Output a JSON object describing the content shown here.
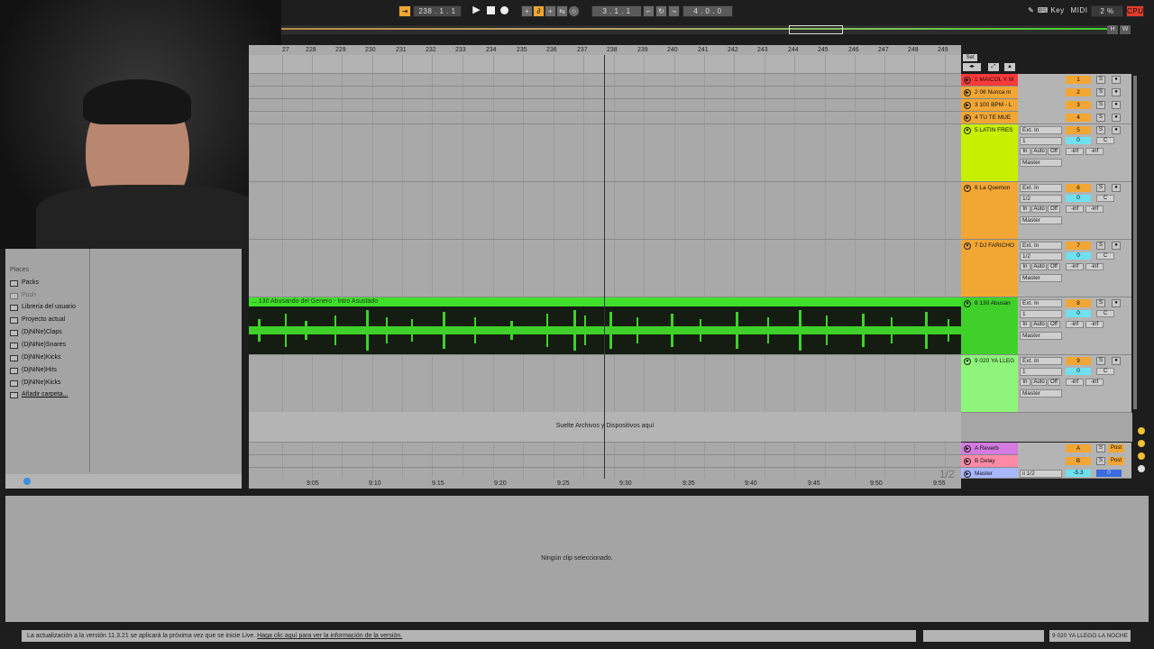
{
  "transport": {
    "arrangement_position": "238 .  1 .  1",
    "loop_start": "3 .  1 .  1",
    "loop_length": "4 .  0 .  0",
    "key_label": "Key",
    "midi_label": "MIDI",
    "cpu_value": "2 %",
    "cpu_label": "CPU",
    "h_label": "H",
    "w_label": "W"
  },
  "ruler": {
    "bars": [
      "27",
      "228",
      "229",
      "230",
      "231",
      "232",
      "233",
      "234",
      "235",
      "236",
      "237",
      "238",
      "239",
      "240",
      "241",
      "242",
      "243",
      "244",
      "245",
      "246",
      "247",
      "248",
      "249"
    ],
    "times": [
      "9:05",
      "9:10",
      "9:15",
      "9:20",
      "9:25",
      "9:30",
      "9:35",
      "9:40",
      "9:45",
      "9:50",
      "9:55"
    ],
    "set_label": "Set",
    "page_indicator": "1/2"
  },
  "tracks": [
    {
      "name": "1 MAICOL Y M",
      "number": "1",
      "color": "#ff3a3a"
    },
    {
      "name": "2 06 Nunca m",
      "number": "2",
      "color": "#f2a634"
    },
    {
      "name": "3 100 BPM - L",
      "number": "3",
      "color": "#f2a634"
    },
    {
      "name": "4 TU TE MUE",
      "number": "4",
      "color": "#f2a634"
    },
    {
      "name": "5 LATIN FRES",
      "number": "5",
      "color": "#c7f000",
      "input": "Ext. In",
      "channel": "1",
      "volume": "0",
      "pan": "C",
      "monitor": [
        "In",
        "Auto",
        "Off"
      ],
      "out": "Master",
      "inf1": "-inf",
      "inf2": "-inf"
    },
    {
      "name": "6 La Quemon",
      "number": "6",
      "color": "#f2a634",
      "input": "Ext. In",
      "channel": "1/2",
      "volume": "0",
      "pan": "C",
      "monitor": [
        "In",
        "Auto",
        "Off"
      ],
      "out": "Master",
      "inf1": "-inf",
      "inf2": "-inf"
    },
    {
      "name": "7 DJ FARICHO",
      "number": "7",
      "color": "#f2a634",
      "input": "Ext. In",
      "channel": "1/2",
      "volume": "0",
      "pan": "C",
      "monitor": [
        "In",
        "Auto",
        "Off"
      ],
      "out": "Master",
      "inf1": "-inf",
      "inf2": "-inf"
    },
    {
      "name": "8 130 Abusan",
      "number": "8",
      "color": "#3fd12a",
      "input": "Ext. In",
      "channel": "1",
      "volume": "0",
      "pan": "C",
      "monitor": [
        "In",
        "Auto",
        "Off"
      ],
      "out": "Master",
      "inf1": "-inf",
      "inf2": "-inf"
    },
    {
      "name": "9 020 YA LLEG",
      "number": "9",
      "color": "#8ef57a",
      "input": "Ext. In",
      "channel": "1",
      "volume": "0",
      "pan": "C",
      "monitor": [
        "In",
        "Auto",
        "Off"
      ],
      "out": "Master",
      "inf1": "-inf",
      "inf2": "-inf"
    }
  ],
  "returns": [
    {
      "name": "A Reverb",
      "letter": "A",
      "color": "#d37be0",
      "post": "Post"
    },
    {
      "name": "B Delay",
      "letter": "B",
      "color": "#ff8aa8",
      "post": "Post"
    }
  ],
  "master": {
    "name": "Master",
    "routing": "ii 1/2",
    "volume": "-5.3",
    "pan": "0",
    "color": "#a8b7ff"
  },
  "clip": {
    "title": "... 130 Abusando del Genero - Intro Asustado",
    "color": "#3fe02a"
  },
  "drop_hint": "Suelte Archivos y Dispositivos aquí",
  "browser": {
    "places_header": "Places",
    "items": [
      "Packs",
      "Push",
      "Librería del usuario",
      "Proyecto actual",
      "(DjNiNe)Claps",
      "(DjNiNe)Snares",
      "(DjNiNe)Kicks",
      "(DjNiNe)Hits",
      "(DjNiNe)Kicks",
      "Añadir carpeta..."
    ]
  },
  "detail": {
    "empty_message": "Ningún clip seleccionado."
  },
  "status": {
    "message": "La actualización a la versión 11.3.21 se aplicará la próxima vez que se inicie Live.",
    "link": "Haga clic aquí para ver la información de la versión.",
    "selected_track": "9 020 YA LLEGO LA NOCHE"
  }
}
